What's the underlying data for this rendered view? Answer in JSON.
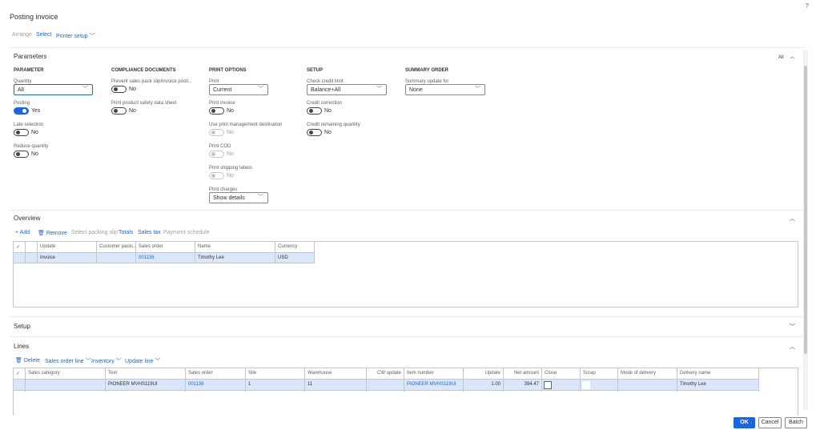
{
  "title": "Posting invoice",
  "help": "?",
  "toolbar": {
    "arrange": "Arrange",
    "select": "Select",
    "printer_setup": "Printer setup"
  },
  "parameters": {
    "header": "Parameters",
    "all": "All",
    "parameter": {
      "header": "PARAMETER",
      "quantity_label": "Quantity",
      "quantity": "All",
      "posting_label": "Posting",
      "posting": "Yes",
      "late_selection_label": "Late selection",
      "late_selection": "No",
      "reduce_quantity_label": "Reduce quantity",
      "reduce_quantity": "No"
    },
    "compliance": {
      "header": "COMPLIANCE DOCUMENTS",
      "prevent_label": "Prevent sales pack slip/invoice posti...",
      "prevent": "No",
      "safety_label": "Print product safety data sheet",
      "safety": "No"
    },
    "print": {
      "header": "PRINT OPTIONS",
      "print_label": "Print",
      "print": "Current",
      "invoice_label": "Print invoice",
      "invoice": "No",
      "pm_label": "Use print management destination",
      "pm": "No",
      "cod_label": "Print COD",
      "cod": "No",
      "shipping_label": "Print shipping labels",
      "shipping": "No",
      "charges_label": "Print charges",
      "charges": "Show details"
    },
    "setup": {
      "header": "SETUP",
      "credit_limit_label": "Check credit limit",
      "credit_limit": "Balance+All",
      "credit_correction_label": "Credit correction",
      "credit_correction": "No",
      "credit_remaining_label": "Credit remaining quantity",
      "credit_remaining": "No"
    },
    "summary": {
      "header": "SUMMARY ORDER",
      "update_for_label": "Summary update for",
      "update_for": "None"
    }
  },
  "overview": {
    "header": "Overview",
    "add": "Add",
    "remove": "Remove",
    "select_packing_slip": "Select packing slip",
    "totals": "Totals",
    "sales_tax": "Sales tax",
    "payment_schedule": "Payment schedule",
    "columns": [
      "Update",
      "Customer packi...",
      "Sales order",
      "Name",
      "Currency"
    ],
    "rows": [
      [
        "Invoice",
        "",
        "001136",
        "Timothy Lee",
        "USD"
      ]
    ]
  },
  "setup_section": {
    "header": "Setup"
  },
  "lines": {
    "header": "Lines",
    "delete": "Delete",
    "sales_order_line": "Sales order line",
    "inventory": "Inventory",
    "update_line": "Update line",
    "columns": [
      "Sales category",
      "Text",
      "Sales order",
      "Site",
      "Warehouse",
      "CW update",
      "Item number",
      "Update",
      "Net amount",
      "Close",
      "Scrap",
      "Mode of delivery",
      "Delivery name"
    ],
    "rows": [
      [
        "",
        "PIONEER MVHS119UI",
        "001136",
        "1",
        "11",
        "",
        "PIONEER MVHS119UI",
        "1.00",
        "394.47",
        "",
        "",
        "",
        "Timothy Lee"
      ]
    ]
  },
  "footer": {
    "ok": "OK",
    "cancel": "Cancel",
    "batch": "Batch"
  }
}
